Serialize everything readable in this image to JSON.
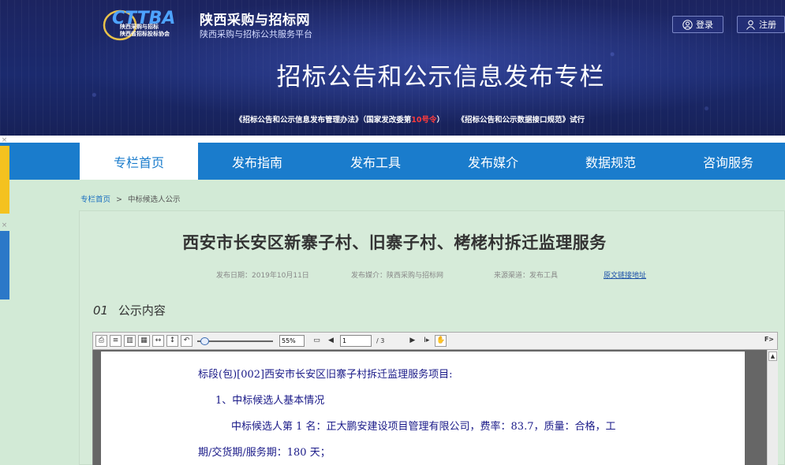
{
  "header": {
    "logo": {
      "mark": "CTTBA",
      "line1": "陕西采购与招标",
      "line2": "陕西省招标投标协会"
    },
    "site_title": "陕西采购与招标网",
    "site_subtitle": "陕西采购与招标公共服务平台",
    "login_label": "登录",
    "register_label": "注册",
    "banner_title": "招标公告和公示信息发布专栏",
    "banner_note": {
      "part1": "《招标公告和公示信息发布管理办法》（国家发改委第",
      "red": "10号令",
      "part2": "）     《招标公告和公示数据接口规范》试行"
    }
  },
  "nav": {
    "items": [
      {
        "label": "专栏首页"
      },
      {
        "label": "发布指南"
      },
      {
        "label": "发布工具"
      },
      {
        "label": "发布媒介"
      },
      {
        "label": "数据规范"
      },
      {
        "label": "咨询服务"
      }
    ]
  },
  "breadcrumb": {
    "home": "专栏首页",
    "separator": ">",
    "current": "中标候选人公示"
  },
  "article": {
    "title": "西安市长安区新寨子村、旧寨子村、栲栳村拆迁监理服务",
    "publish_date": "发布日期：2019年10月11日",
    "publish_media": "发布媒介：陕西采购与招标网",
    "source_channel": "来源渠道：发布工具",
    "source_link": "原文链接地址",
    "section_number": "01",
    "section_title": "公示内容"
  },
  "pdf_viewer": {
    "zoom_value": "55%",
    "page_current": "1",
    "page_total": "/ 3",
    "right_label": "F>",
    "lines": [
      "标段(包)[002]西安市长安区旧寨子村拆迁监理服务项目:",
      "1、中标候选人基本情况",
      "中标候选人第 1 名：正大鹏安建设项目管理有限公司，费率：83.7，质量：合格，工",
      "期/交货期/服务期：180 天；"
    ]
  },
  "colors": {
    "nav_blue": "#1a7ccc",
    "header_navy": "#1c2460",
    "page_bg": "#d2ead6",
    "pdf_text": "#1a1a88",
    "highlight_red": "#ff3b3b"
  }
}
